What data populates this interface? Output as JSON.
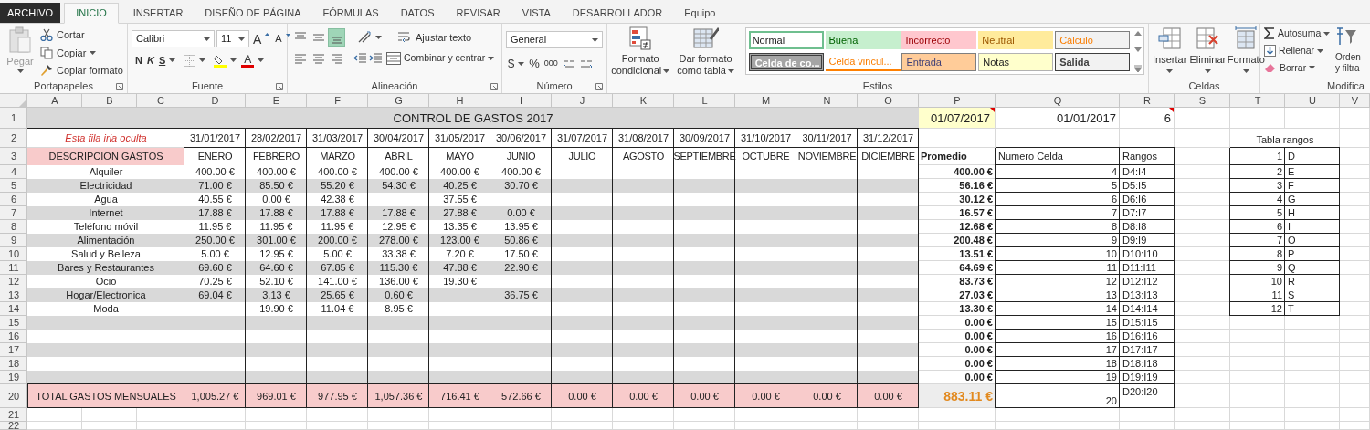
{
  "tabs": [
    {
      "label": "ARCHIVO",
      "kind": "file",
      "selected": false
    },
    {
      "label": "INICIO",
      "kind": "tab",
      "selected": true
    },
    {
      "label": "INSERTAR",
      "kind": "tab",
      "selected": false
    },
    {
      "label": "DISEÑO DE PÁGINA",
      "kind": "tab",
      "selected": false
    },
    {
      "label": "FÓRMULAS",
      "kind": "tab",
      "selected": false
    },
    {
      "label": "DATOS",
      "kind": "tab",
      "selected": false
    },
    {
      "label": "REVISAR",
      "kind": "tab",
      "selected": false
    },
    {
      "label": "VISTA",
      "kind": "tab",
      "selected": false
    },
    {
      "label": "DESARROLLADOR",
      "kind": "tab",
      "selected": false
    },
    {
      "label": "Equipo",
      "kind": "tab",
      "selected": false
    }
  ],
  "ribbon": {
    "clipboard": {
      "group": "Portapapeles",
      "launcher": true,
      "paste": {
        "label": "Pegar",
        "disabled": true
      },
      "cut": "Cortar",
      "copy": "Copiar",
      "format_painter": "Copiar formato"
    },
    "font": {
      "group": "Fuente",
      "launcher": true,
      "family": "Calibri",
      "size": "11",
      "grow": "A",
      "shrink": "A",
      "bold": "N",
      "italic": "K",
      "underline": "S",
      "font_color": "A"
    },
    "alignment": {
      "group": "Alineación",
      "launcher": true,
      "buttons": [
        {
          "kind": "top",
          "selected": false
        },
        {
          "kind": "middle",
          "selected": false
        },
        {
          "kind": "bottom",
          "selected": true
        },
        {
          "kind": "left",
          "selected": false
        },
        {
          "kind": "center",
          "selected": false
        },
        {
          "kind": "right",
          "selected": false
        }
      ],
      "wrap": "Ajustar texto",
      "merge": "Combinar y centrar"
    },
    "number": {
      "group": "Número",
      "launcher": true,
      "format": "General",
      "currency": "$",
      "percent": "%",
      "thousands": "000"
    },
    "styles": {
      "group": "Estilos",
      "conditional": [
        "Formato",
        "condicional"
      ],
      "as_table": [
        "Dar formato",
        "como tabla"
      ],
      "gallery": [
        {
          "label": "Normal",
          "kind": "normal",
          "selected": true
        },
        {
          "label": "Buena",
          "kind": "good",
          "selected": false
        },
        {
          "label": "Incorrecto",
          "kind": "bad",
          "selected": false
        },
        {
          "label": "Neutral",
          "kind": "neutral",
          "selected": false
        },
        {
          "label": "Cálculo",
          "kind": "calculation",
          "selected": false
        },
        {
          "label": "Celda de co...",
          "kind": "check",
          "selected": false
        },
        {
          "label": "Celda vincul...",
          "kind": "linked",
          "selected": false
        },
        {
          "label": "Entrada",
          "kind": "input",
          "selected": false
        },
        {
          "label": "Notas",
          "kind": "note",
          "selected": false
        },
        {
          "label": "Salida",
          "kind": "output",
          "selected": false
        }
      ]
    },
    "cells": {
      "group": "Celdas",
      "buttons": [
        {
          "label": "Insertar",
          "kind": "insert"
        },
        {
          "label": "Eliminar",
          "kind": "delete"
        },
        {
          "label": "Formato",
          "kind": "format"
        }
      ]
    },
    "editing": {
      "group": "Modifica",
      "items": [
        {
          "label": "Autosuma",
          "kind": "sum"
        },
        {
          "label": "Rellenar",
          "kind": "fill"
        },
        {
          "label": "Borrar",
          "kind": "clear"
        }
      ],
      "sort": [
        "Orden",
        "y filtra"
      ]
    }
  },
  "sheet": {
    "columns": [
      "A",
      "B",
      "C",
      "D",
      "E",
      "F",
      "G",
      "H",
      "I",
      "J",
      "K",
      "L",
      "M",
      "N",
      "O",
      "P",
      "Q",
      "R",
      "S",
      "T",
      "U",
      "V"
    ],
    "rows": [
      "1",
      "2",
      "3",
      "4",
      "5",
      "6",
      "7",
      "8",
      "9",
      "10",
      "11",
      "12",
      "13",
      "14",
      "15",
      "16",
      "17",
      "18",
      "19",
      "20",
      "21",
      "22"
    ],
    "title": "CONTROL DE GASTOS 2017",
    "p1": {
      "value": "01/07/2017",
      "comment": true
    },
    "q1": "01/01/2017",
    "r1": {
      "value": "6",
      "comment": true
    },
    "note": "Esta fila iria oculta",
    "dates": [
      "31/01/2017",
      "28/02/2017",
      "31/03/2017",
      "30/04/2017",
      "31/05/2017",
      "30/06/2017",
      "31/07/2017",
      "31/08/2017",
      "30/09/2017",
      "31/10/2017",
      "30/11/2017",
      "31/12/2017"
    ],
    "description_header": "DESCRIPCION GASTOS",
    "months": [
      "ENERO",
      "FEBRERO",
      "MARZO",
      "ABRIL",
      "MAYO",
      "JUNIO",
      "JULIO",
      "AGOSTO",
      "SEPTIEMBRE",
      "OCTUBRE",
      "NOVIEMBRE",
      "DICIEMBRE"
    ],
    "expenses": [
      {
        "label": "Alquiler",
        "amounts": {
          "jan": "400.00 €",
          "feb": "400.00 €",
          "mar": "400.00 €",
          "apr": "400.00 €",
          "may": "400.00 €",
          "jun": "400.00 €"
        }
      },
      {
        "label": "Electricidad",
        "amounts": {
          "jan": "71.00 €",
          "feb": "85.50 €",
          "mar": "55.20 €",
          "apr": "54.30 €",
          "may": "40.25 €",
          "jun": "30.70 €"
        }
      },
      {
        "label": "Agua",
        "amounts": {
          "jan": "40.55 €",
          "feb": "0.00 €",
          "mar": "42.38 €",
          "may": "37.55 €"
        }
      },
      {
        "label": "Internet",
        "amounts": {
          "jan": "17.88 €",
          "feb": "17.88 €",
          "mar": "17.88 €",
          "apr": "17.88 €",
          "may": "27.88 €",
          "jun": "0.00 €"
        }
      },
      {
        "label": "Teléfono móvil",
        "amounts": {
          "jan": "11.95 €",
          "feb": "11.95 €",
          "mar": "11.95 €",
          "apr": "12.95 €",
          "may": "13.35 €",
          "jun": "13.95 €"
        }
      },
      {
        "label": "Alimentación",
        "amounts": {
          "jan": "250.00 €",
          "feb": "301.00 €",
          "mar": "200.00 €",
          "apr": "278.00 €",
          "may": "123.00 €",
          "jun": "50.86 €"
        }
      },
      {
        "label": "Salud y Belleza",
        "amounts": {
          "jan": "5.00 €",
          "feb": "12.95 €",
          "mar": "5.00 €",
          "apr": "33.38 €",
          "may": "7.20 €",
          "jun": "17.50 €"
        }
      },
      {
        "label": "Bares y Restaurantes",
        "amounts": {
          "jan": "69.60 €",
          "feb": "64.60 €",
          "mar": "67.85 €",
          "apr": "115.30 €",
          "may": "47.88 €",
          "jun": "22.90 €"
        }
      },
      {
        "label": "Ocio",
        "amounts": {
          "jan": "70.25 €",
          "feb": "52.10 €",
          "mar": "141.00 €",
          "apr": "136.00 €",
          "may": "19.30 €"
        }
      },
      {
        "label": "Hogar/Electronica",
        "amounts": {
          "jan": "69.04 €",
          "feb": "3.13 €",
          "mar": "25.65 €",
          "apr": "0.60 €",
          "jun": "36.75 €"
        }
      },
      {
        "label": "Moda",
        "amounts": {
          "feb": "19.90 €",
          "mar": "11.04 €",
          "apr": "8.95 €"
        }
      }
    ],
    "total_label": "TOTAL GASTOS MENSUALES",
    "totals": [
      "1,005.27 €",
      "969.01 €",
      "977.95 €",
      "1,057.36 €",
      "716.41 €",
      "572.66 €",
      "0.00 €",
      "0.00 €",
      "0.00 €",
      "0.00 €",
      "0.00 €",
      "0.00 €"
    ],
    "average_header": "Promedio",
    "cell_number_header": "Numero Celda",
    "ranges_header": "Rangos",
    "summary": [
      {
        "average": "400.00 €",
        "cell": "4",
        "range": "D4:I4"
      },
      {
        "average": "56.16 €",
        "cell": "5",
        "range": "D5:I5"
      },
      {
        "average": "30.12 €",
        "cell": "6",
        "range": "D6:I6"
      },
      {
        "average": "16.57 €",
        "cell": "7",
        "range": "D7:I7"
      },
      {
        "average": "12.68 €",
        "cell": "8",
        "range": "D8:I8"
      },
      {
        "average": "200.48 €",
        "cell": "9",
        "range": "D9:I9"
      },
      {
        "average": "13.51 €",
        "cell": "10",
        "range": "D10:I10"
      },
      {
        "average": "64.69 €",
        "cell": "11",
        "range": "D11:I11"
      },
      {
        "average": "83.73 €",
        "cell": "12",
        "range": "D12:I12"
      },
      {
        "average": "27.03 €",
        "cell": "13",
        "range": "D13:I13"
      },
      {
        "average": "13.30 €",
        "cell": "14",
        "range": "D14:I14"
      },
      {
        "average": "0.00 €",
        "cell": "15",
        "range": "D15:I15"
      },
      {
        "average": "0.00 €",
        "cell": "16",
        "range": "D16:I16"
      },
      {
        "average": "0.00 €",
        "cell": "17",
        "range": "D17:I17"
      },
      {
        "average": "0.00 €",
        "cell": "18",
        "range": "D18:I18"
      },
      {
        "average": "0.00 €",
        "cell": "19",
        "range": "D19:I19"
      }
    ],
    "summary_total": {
      "average": "883.11 €",
      "cell": "20",
      "range": "D20:I20"
    },
    "range_table": {
      "title": "Tabla rangos",
      "rows": [
        {
          "n": "1",
          "column": "D"
        },
        {
          "n": "2",
          "column": "E"
        },
        {
          "n": "3",
          "column": "F"
        },
        {
          "n": "4",
          "column": "G"
        },
        {
          "n": "5",
          "column": "H"
        },
        {
          "n": "6",
          "column": "I"
        },
        {
          "n": "7",
          "column": "O"
        },
        {
          "n": "8",
          "column": "P"
        },
        {
          "n": "9",
          "column": "Q"
        },
        {
          "n": "10",
          "column": "R"
        },
        {
          "n": "11",
          "column": "S"
        },
        {
          "n": "12",
          "column": "T"
        }
      ]
    }
  }
}
